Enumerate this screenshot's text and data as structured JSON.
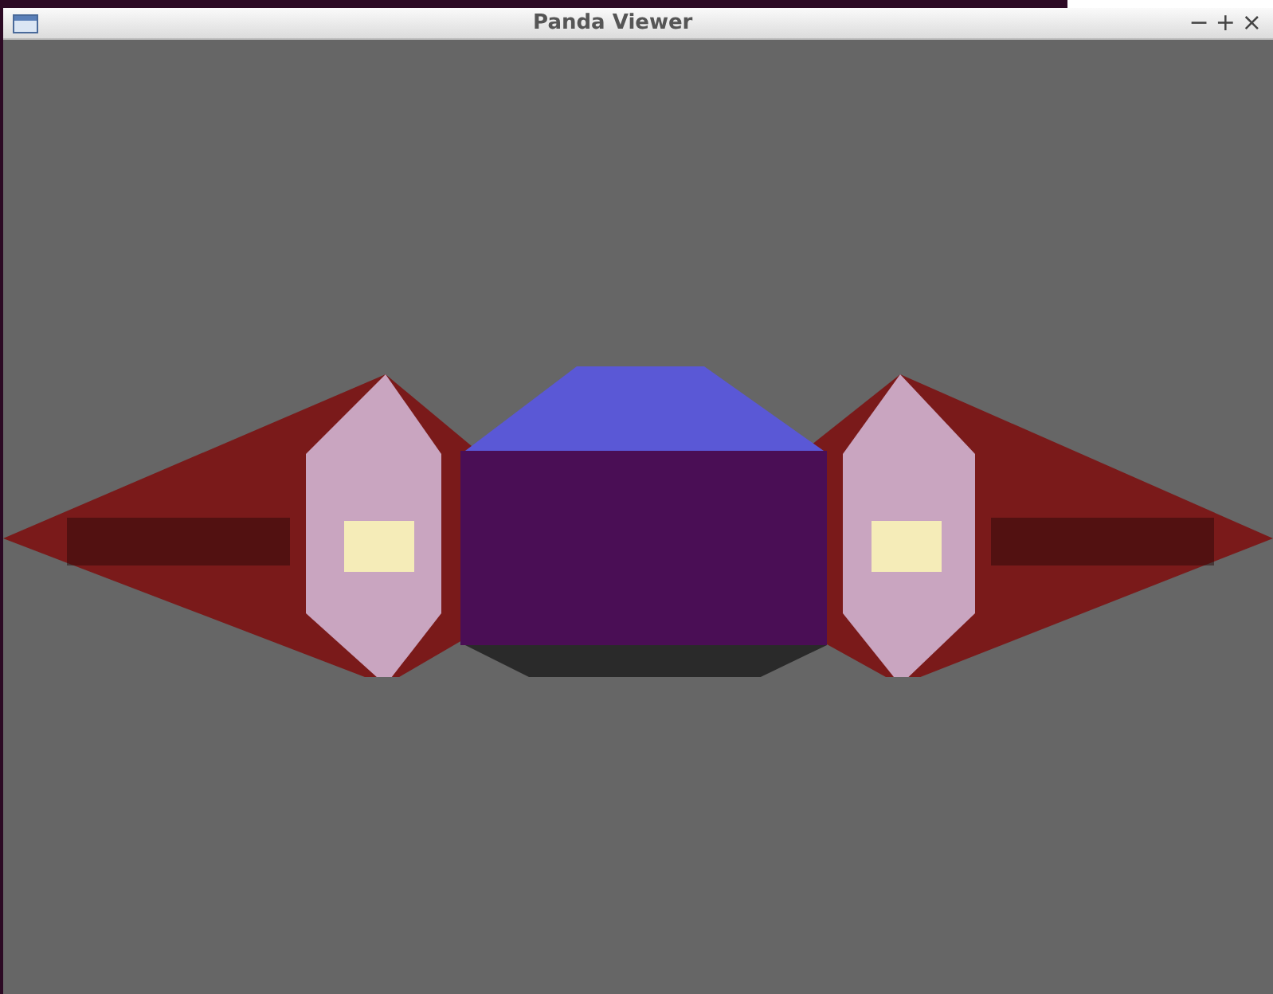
{
  "window": {
    "title": "Panda Viewer",
    "controls": [
      "−",
      "+",
      "×"
    ]
  }
}
